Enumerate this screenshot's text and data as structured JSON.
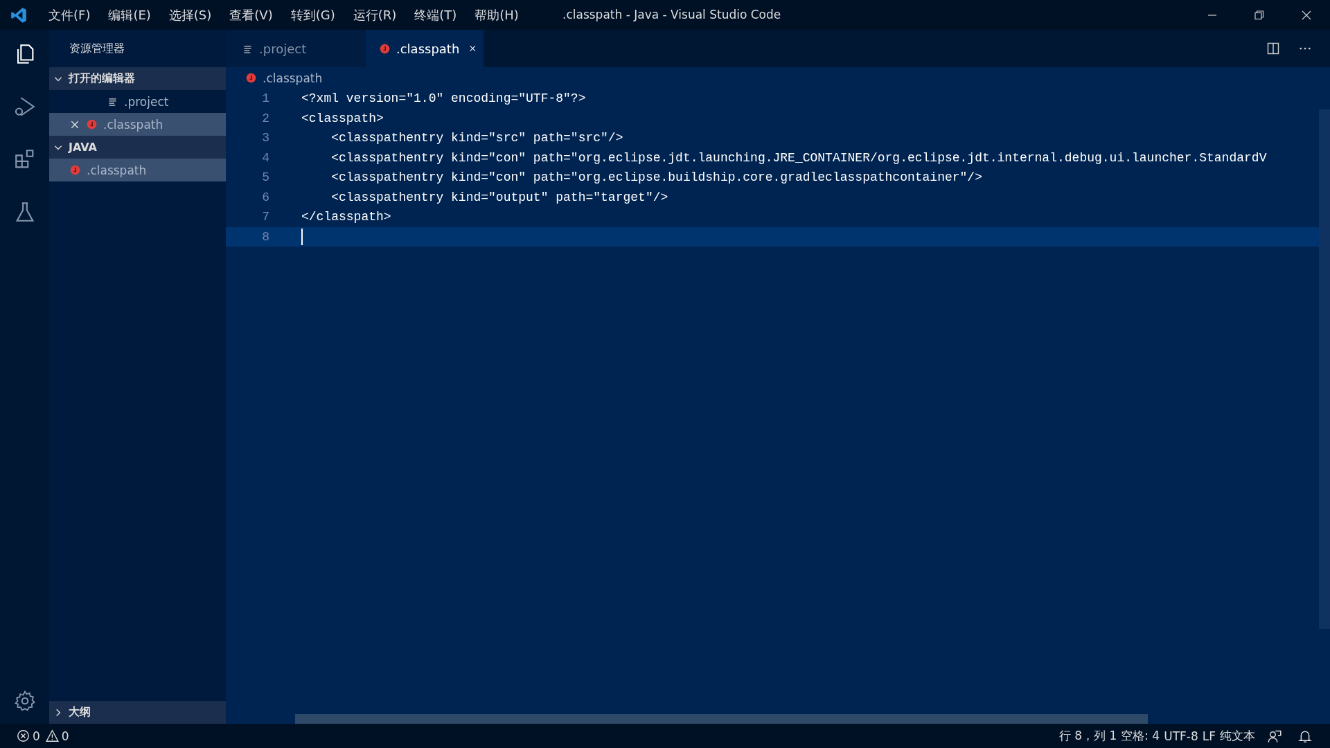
{
  "window": {
    "title": ".classpath - Java - Visual Studio Code"
  },
  "menu": [
    "文件(F)",
    "编辑(E)",
    "选择(S)",
    "查看(V)",
    "转到(G)",
    "运行(R)",
    "终端(T)",
    "帮助(H)"
  ],
  "sidebar": {
    "title": "资源管理器",
    "sections": [
      {
        "label": "打开的编辑器",
        "expanded": true,
        "items": [
          {
            "label": ".project",
            "kind": "lines",
            "selected": false,
            "closable": false
          },
          {
            "label": ".classpath",
            "kind": "java",
            "selected": true,
            "closable": true
          }
        ]
      },
      {
        "label": "JAVA",
        "expanded": true,
        "items": [
          {
            "label": ".classpath",
            "kind": "java",
            "selected": true,
            "closable": false
          }
        ]
      }
    ],
    "outline": {
      "label": "大纲",
      "expanded": false
    }
  },
  "tabs": [
    {
      "label": ".project",
      "kind": "lines",
      "selected": false
    },
    {
      "label": ".classpath",
      "kind": "java",
      "selected": true
    }
  ],
  "breadcrumb": ".classpath",
  "editor": {
    "lines": [
      {
        "number": "1",
        "text": "<?xml version=\"1.0\" encoding=\"UTF-8\"?>",
        "current": false
      },
      {
        "number": "2",
        "text": "<classpath>",
        "current": false
      },
      {
        "number": "3",
        "text": "    <classpathentry kind=\"src\" path=\"src\"/>",
        "current": false
      },
      {
        "number": "4",
        "text": "    <classpathentry kind=\"con\" path=\"org.eclipse.jdt.launching.JRE_CONTAINER/org.eclipse.jdt.internal.debug.ui.launcher.StandardV",
        "current": false
      },
      {
        "number": "5",
        "text": "    <classpathentry kind=\"con\" path=\"org.eclipse.buildship.core.gradleclasspathcontainer\"/>",
        "current": false
      },
      {
        "number": "6",
        "text": "    <classpathentry kind=\"output\" path=\"target\"/>",
        "current": false
      },
      {
        "number": "7",
        "text": "</classpath>",
        "current": false
      },
      {
        "number": "8",
        "current": true
      }
    ]
  },
  "status_bar": {
    "errors": "0",
    "warnings": "0",
    "right": [
      "行 8，列 1",
      "空格: 4",
      "UTF-8",
      "LF",
      "纯文本"
    ]
  }
}
